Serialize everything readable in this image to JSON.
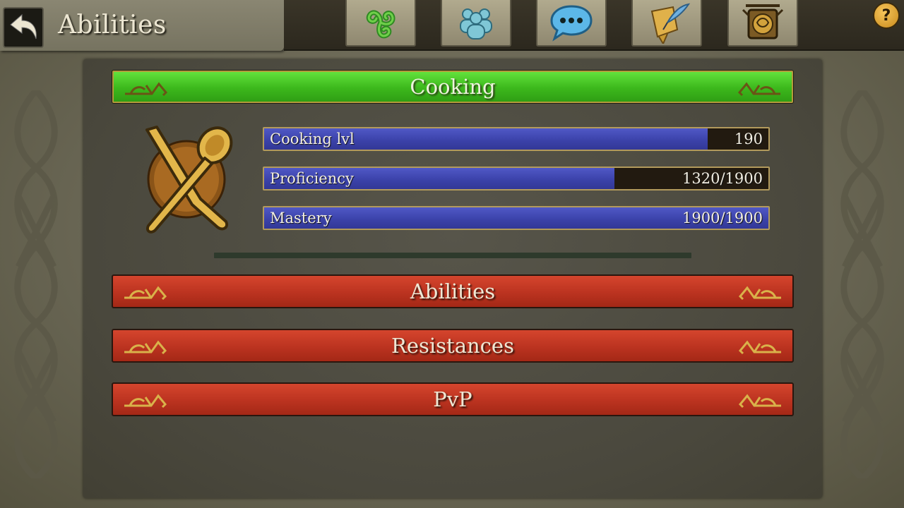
{
  "header": {
    "title": "Abilities",
    "help_label": "?",
    "tabs": [
      {
        "name": "triskele-tab",
        "icon": "triskele-icon"
      },
      {
        "name": "party-tab",
        "icon": "group-icon"
      },
      {
        "name": "chat-tab",
        "icon": "chat-icon"
      },
      {
        "name": "quests-tab",
        "icon": "scroll-quill-icon"
      },
      {
        "name": "guild-tab",
        "icon": "guild-sign-icon"
      }
    ]
  },
  "skill": {
    "title": "Cooking",
    "icon": "knife-spoon-icon",
    "stats": [
      {
        "label": "Cooking lvl",
        "value": "190",
        "progress": 0.88
      },
      {
        "label": "Proficiency",
        "value": "1320/1900",
        "progress": 0.695
      },
      {
        "label": "Mastery",
        "value": "1900/1900",
        "progress": 1.0
      }
    ]
  },
  "sections": [
    {
      "label": "Abilities"
    },
    {
      "label": "Resistances"
    },
    {
      "label": "PvP"
    }
  ],
  "colors": {
    "active_header": "#3cb81c",
    "section_header": "#bb3320",
    "stat_fill": "#3a41a8"
  }
}
